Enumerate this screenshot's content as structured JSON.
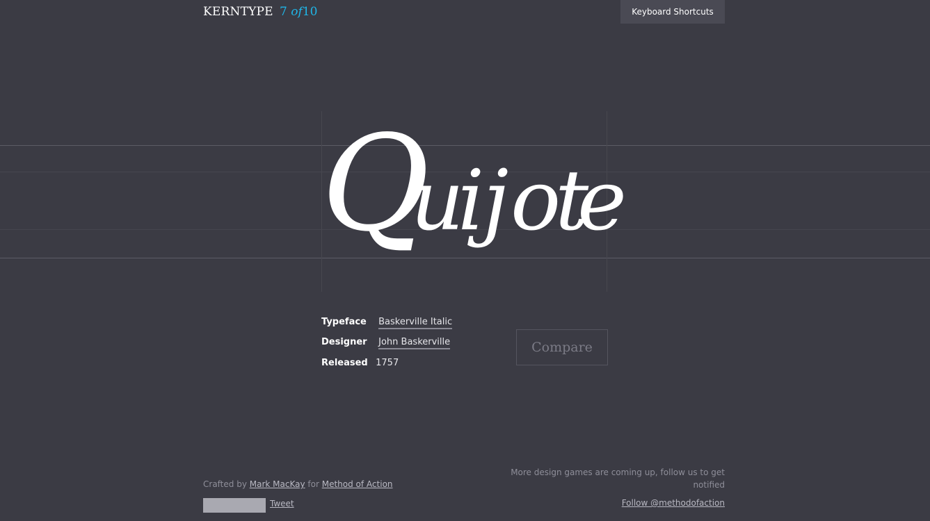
{
  "header": {
    "brand": "KERNTYPE",
    "progress_current": "7",
    "progress_of": "of",
    "progress_total": "10",
    "shortcuts_label": "Keyboard Shortcuts"
  },
  "game": {
    "word": "Quijote",
    "letters": [
      "Q",
      "u",
      "i",
      "j",
      "o",
      "t",
      "e"
    ]
  },
  "info": {
    "typeface_label": "Typeface",
    "typeface_value": "Baskerville Italic",
    "designer_label": "Designer",
    "designer_value": "John Baskerville",
    "released_label": "Released",
    "released_value": "1757",
    "compare_label": "Compare"
  },
  "footer": {
    "crafted_prefix": "Crafted by",
    "author": "Mark MacKay",
    "for_text": "for",
    "company": "Method of Action",
    "tweet_label": "Tweet",
    "more_games_text": "More design games are coming up, follow us to get notified",
    "follow_label": "Follow @methodofaction"
  },
  "colors": {
    "background": "#3b3b44",
    "accent": "#1fb6e8",
    "text": "#ffffff",
    "muted": "#8e8e99"
  }
}
